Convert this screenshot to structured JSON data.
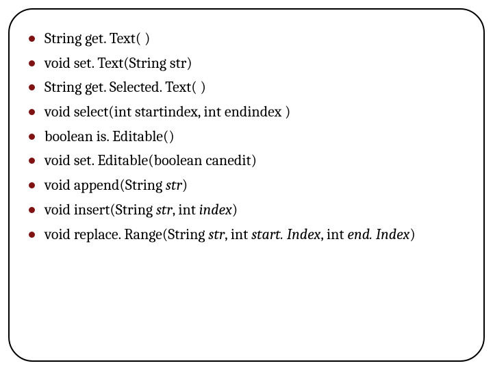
{
  "methods": [
    {
      "pre": "String get. Text( )",
      "em": "",
      "post": ""
    },
    {
      "pre": "void set. Text(String str)",
      "em": "",
      "post": ""
    },
    {
      "pre": "String get. Selected. Text( )",
      "em": "",
      "post": ""
    },
    {
      "pre": "void select(int startindex, int endindex )",
      "em": "",
      "post": ""
    },
    {
      "pre": "boolean is. Editable()",
      "em": "",
      "post": ""
    },
    {
      "pre": "void set. Editable(boolean canedit)",
      "em": "",
      "post": ""
    },
    {
      "pre": "void append(String ",
      "em": "str",
      "post": ")"
    },
    {
      "pre": "void insert(String ",
      "em": "str",
      "post": ", int index)",
      "em2": "index",
      "tail": ")"
    },
    {
      "pre": "void replace. Range(String ",
      "em": "str",
      "post": ", int ",
      "em2": "start. Index",
      "mid": ", int ",
      "em3": "end. Index",
      "tail": ")"
    }
  ]
}
